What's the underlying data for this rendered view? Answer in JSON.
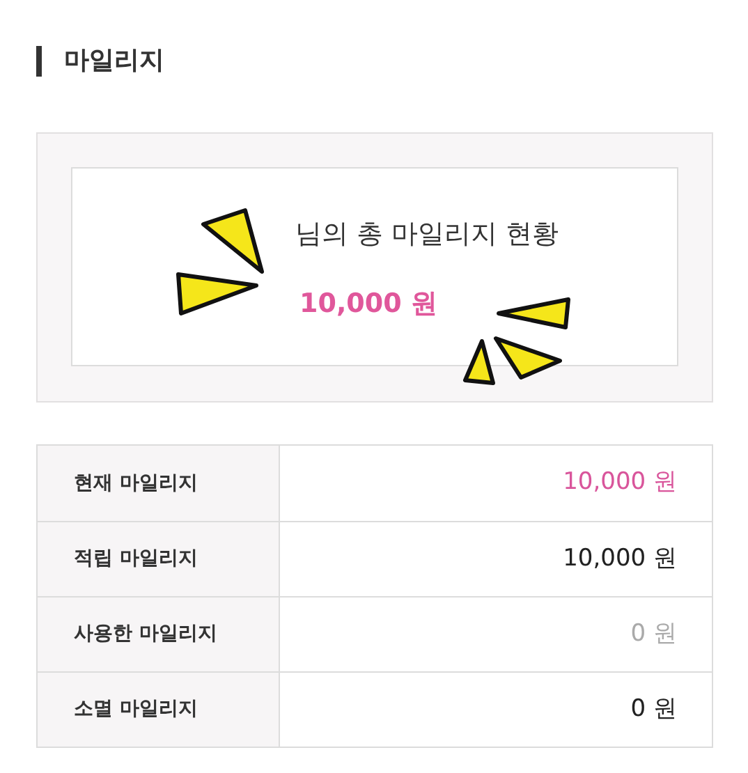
{
  "heading": "마일리지",
  "summary": {
    "title": "님의 총 마일리지 현황",
    "total": "10,000 원"
  },
  "rows": [
    {
      "label": "현재 마일리지",
      "value": "10,000 원",
      "color": "#d9559b"
    },
    {
      "label": "적립 마일리지",
      "value": "10,000 원",
      "color": "#222222"
    },
    {
      "label": "사용한 마일리지",
      "value": "0 원",
      "color": "#aaaaaa"
    },
    {
      "label": "소멸 마일리지",
      "value": "0 원",
      "color": "#222222"
    }
  ]
}
